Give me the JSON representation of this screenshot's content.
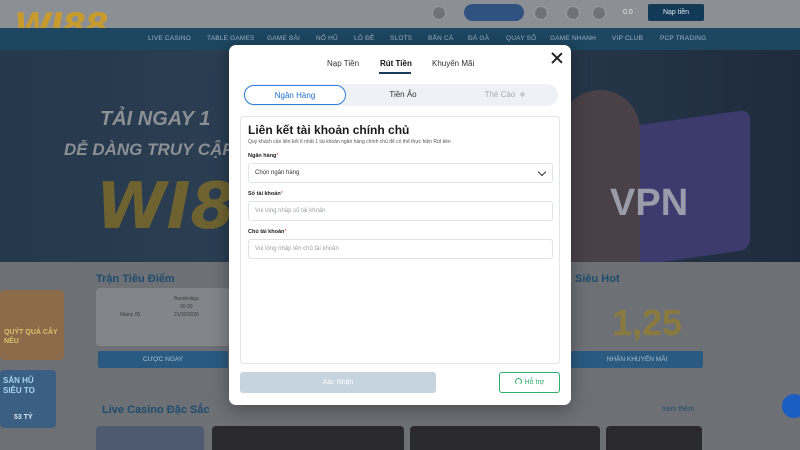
{
  "site": {
    "logo_text": "WI88",
    "header": {
      "balance": "0.0",
      "deposit_button": "Nạp tiền"
    },
    "nav": [
      "LIVE CASINO",
      "TABLE GAMES",
      "GAME BÀI",
      "NỔ HŨ",
      "LÔ ĐỀ",
      "SLOTS",
      "BẮN CÁ",
      "ĐÁ GÀ",
      "QUAY SỐ",
      "GAME NHANH",
      "VIP CLUB",
      "PCP TRADING"
    ],
    "banner": {
      "line1": "TẢI NGAY 1",
      "line2": "DỄ DÀNG TRUY CẬP",
      "logo": "WI8",
      "vpn": "VPN"
    },
    "sections": {
      "match_title": "Trận Tiêu Điểm",
      "match_team": "Mainz 05",
      "match_team2": "Bundesliga",
      "match_time": "00:30",
      "match_date": "21/02/2026",
      "match_button": "CƯỢC NGAY",
      "hot_title": "Siêu Hot",
      "hot_value": "1,25",
      "hot_button": "NHẬN KHUYẾN MÃI",
      "live_title": "Live Casino Đặc Sắc",
      "see_more": "Xem thêm"
    },
    "side_promos": [
      "QUÝT QUẢ CÂY NÊU",
      "SĂN HŨ SIÊU TO",
      "53 TỶ"
    ]
  },
  "modal": {
    "tabs": [
      {
        "label": "Nạp Tiền",
        "active": false
      },
      {
        "label": "Rút Tiền",
        "active": true
      },
      {
        "label": "Khuyến Mãi",
        "active": false
      }
    ],
    "methods": [
      {
        "label": "Ngân Hàng",
        "state": "active"
      },
      {
        "label": "Tiền Ảo",
        "state": "normal"
      },
      {
        "label": "Thẻ Cào",
        "state": "disabled"
      }
    ],
    "form": {
      "title": "Liên kết tài khoản chính chủ",
      "description": "Quý khách cần liên kết ít nhất 1 tài khoản ngân hàng chính chủ để có thể thực hiện Rút tiền",
      "bank_label": "Ngân hàng",
      "bank_value": "Chọn ngân hàng",
      "account_number_label": "Số tài khoản",
      "account_number_placeholder": "Vui lòng nhập số tài khoản",
      "account_owner_label": "Chủ tài khoản",
      "account_owner_placeholder": "Vui lòng nhập tên chủ tài khoản",
      "required_mark": "*"
    },
    "confirm_button": "Xác Nhận",
    "support_button": "Hỗ trợ"
  },
  "colors": {
    "accent_blue": "#2f7ed8",
    "support_green": "#2fae6c",
    "required_red": "#e53935",
    "confirm_disabled": "#c6d4e0"
  }
}
